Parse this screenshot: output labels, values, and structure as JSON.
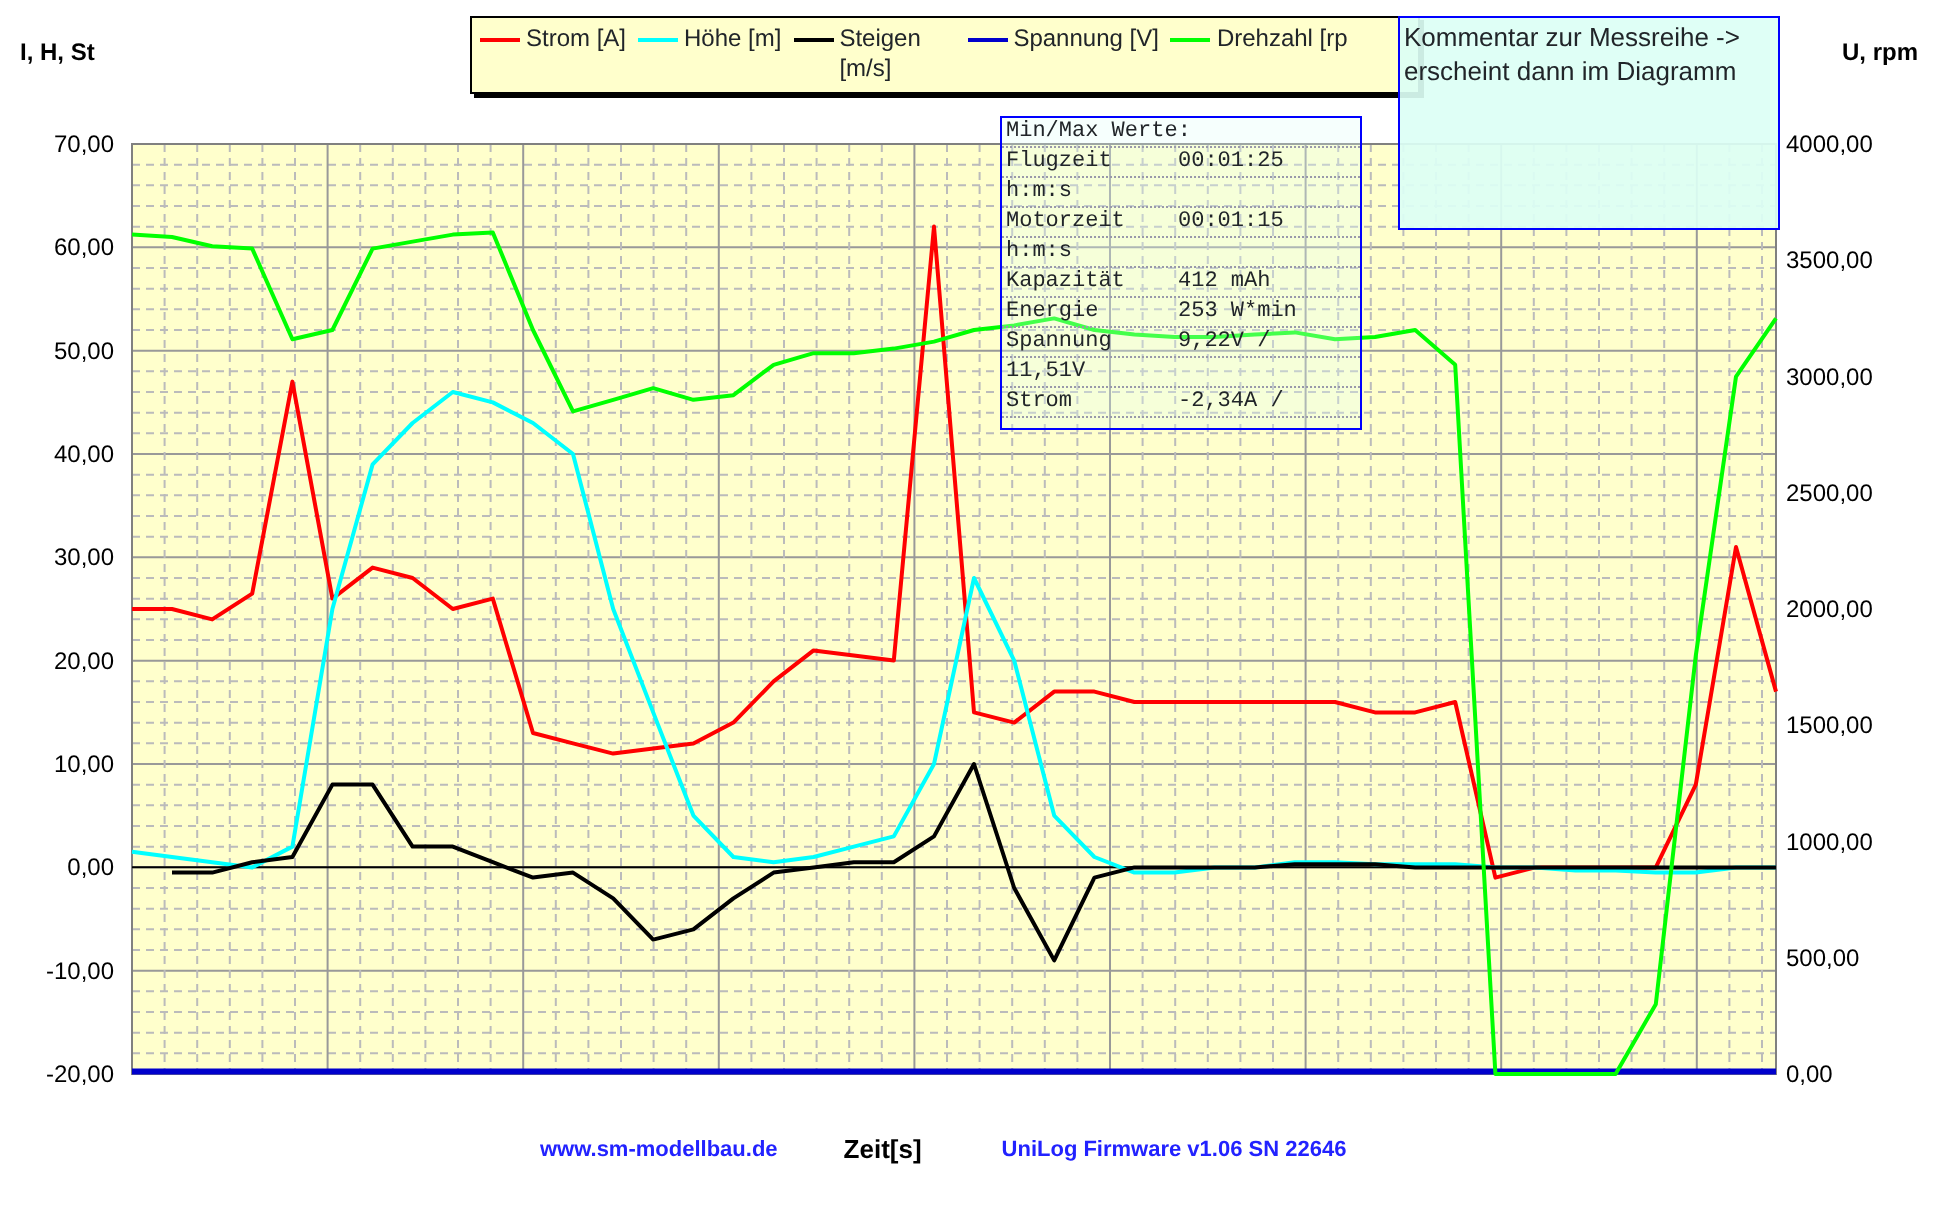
{
  "chart": {
    "right_axis_title": "U, rpm",
    "chart_data": {
      "type": "line",
      "grid": true,
      "xlabel": "Zeit[s]",
      "ylabel": "I, H, St",
      "ylim": [
        -20,
        70
      ],
      "yticks": [
        {
          "value": 70,
          "label": "70,00"
        },
        {
          "value": 60,
          "label": "60,00"
        },
        {
          "value": 50,
          "label": "50,00"
        },
        {
          "value": 40,
          "label": "40,00"
        },
        {
          "value": 30,
          "label": "30,00"
        },
        {
          "value": 20,
          "label": "20,00"
        },
        {
          "value": 10,
          "label": "10,00"
        },
        {
          "value": 0,
          "label": "0,00"
        },
        {
          "value": -10,
          "label": "-10,00"
        },
        {
          "value": -20,
          "label": "-20,00"
        }
      ],
      "y2lim": [
        0,
        4000
      ],
      "y2ticks": [
        {
          "value": 4000,
          "label": "4000,00"
        },
        {
          "value": 3500,
          "label": "3500,00"
        },
        {
          "value": 3000,
          "label": "3000,00"
        },
        {
          "value": 2500,
          "label": "2500,00"
        },
        {
          "value": 2000,
          "label": "2000,00"
        },
        {
          "value": 1500,
          "label": "1500,00"
        },
        {
          "value": 1000,
          "label": "1000,00"
        },
        {
          "value": 500,
          "label": "500,00"
        },
        {
          "value": 0,
          "label": "0,00"
        }
      ],
      "series": [
        {
          "name": "Strom [A]",
          "color": "#ff0000",
          "values": [
            25,
            25,
            24,
            26.5,
            47,
            26,
            29,
            28,
            25,
            26,
            13,
            12,
            11,
            11.5,
            12,
            14,
            18,
            21,
            20.5,
            20,
            62,
            15,
            14,
            17,
            17,
            16,
            16,
            16,
            16,
            16,
            16,
            15,
            15,
            16,
            -1,
            0,
            0,
            0,
            0,
            8,
            31,
            17
          ]
        },
        {
          "name": "Höhe [m]",
          "color": "#00ffff",
          "values": [
            1.5,
            1,
            0.5,
            0,
            2,
            25,
            39,
            43,
            46,
            45,
            43,
            40,
            25,
            15,
            5,
            1,
            0.5,
            1,
            2,
            3,
            10,
            28,
            20,
            5,
            1,
            -0.5,
            -0.5,
            0,
            0,
            0.5,
            0.5,
            0.3,
            0.3,
            0.3,
            0,
            0,
            -0.3,
            -0.3,
            -0.5,
            -0.5,
            0,
            0
          ]
        },
        {
          "name": "Steigen [m/s]",
          "color": "#000000",
          "values": [
            null,
            -0.5,
            -0.5,
            0.5,
            1,
            8,
            8,
            2,
            2,
            0.5,
            -1,
            -0.5,
            -3,
            -7,
            -6,
            -3,
            -0.5,
            0,
            0.5,
            0.5,
            3,
            10,
            -2,
            -9,
            -1,
            0,
            0,
            0,
            0,
            0.3,
            0.3,
            0.3,
            0,
            0,
            0,
            0,
            0,
            0,
            0,
            0,
            0,
            0
          ]
        },
        {
          "name": "Spannung [V]",
          "color": "#0000cc",
          "axis": "y2",
          "values": [
            10,
            10,
            10,
            10,
            10,
            10,
            10,
            10,
            10,
            10,
            10,
            10,
            10,
            10,
            10,
            10,
            10,
            10,
            10,
            10,
            10,
            10,
            10,
            10,
            10,
            10,
            10,
            10,
            10,
            10,
            10,
            10,
            10,
            10,
            10,
            10,
            10,
            10,
            10,
            10,
            10,
            10
          ]
        },
        {
          "name": "Drehzahl [rp",
          "color": "#00ff00",
          "axis": "y2",
          "values": [
            3610,
            3600,
            3560,
            3550,
            3160,
            3200,
            3550,
            3580,
            3610,
            3620,
            3200,
            2850,
            2900,
            2950,
            2900,
            2920,
            3050,
            3100,
            3100,
            3120,
            3150,
            3200,
            3220,
            3250,
            3200,
            3180,
            3170,
            3170,
            3180,
            3190,
            3160,
            3170,
            3200,
            3050,
            0,
            0,
            0,
            0,
            300,
            1800,
            3000,
            3250
          ]
        }
      ]
    }
  },
  "info_box": {
    "rows": [
      {
        "label": "Min/Max Werte:",
        "value": ""
      },
      {
        "label": "Flugzeit",
        "value": "00:01:25"
      },
      {
        "label": "h:m:s",
        "value": ""
      },
      {
        "label": "Motorzeit",
        "value": "00:01:15"
      },
      {
        "label": "h:m:s",
        "value": ""
      },
      {
        "label": "Kapazität",
        "value": "412 mAh"
      },
      {
        "label": "Energie",
        "value": "253 W*min"
      },
      {
        "label": "Spannung",
        "value": "9,22V /"
      },
      {
        "label": "11,51V",
        "value": ""
      },
      {
        "label": "Strom",
        "value": "-2,34A /"
      }
    ]
  },
  "comment_box": {
    "text": "Kommentar zur Messreihe -> erscheint dann im Diagramm"
  },
  "footer": {
    "link": "www.sm-modellbau.de",
    "firmware": "UniLog Firmware v1.06 SN 22646"
  }
}
